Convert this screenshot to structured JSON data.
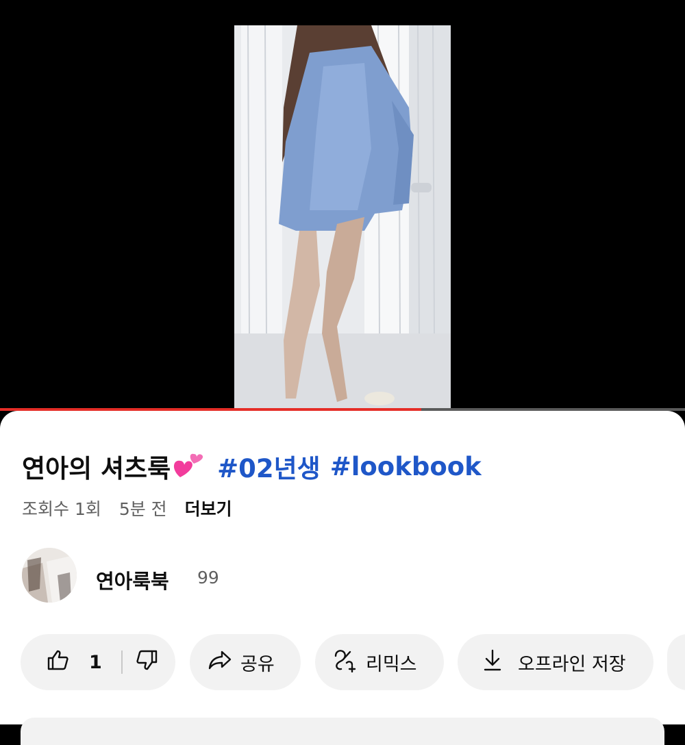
{
  "video": {
    "progress": 0.615,
    "title": "연아의 셔츠룩",
    "title_emoji": "two-hearts-emoji",
    "hashtags": [
      "#02년생",
      "#lookbook"
    ],
    "views": "조회수 1회",
    "uploaded": "5분 전",
    "more_label": "더보기"
  },
  "channel": {
    "name": "연아룩북",
    "subscribers": "99"
  },
  "actions": {
    "like_count": "1",
    "share_label": "공유",
    "remix_label": "리믹스",
    "download_label": "오프라인 저장"
  },
  "colors": {
    "progress": "#e52d27",
    "hashtag": "#1f57c8",
    "pill_bg": "#f2f2f2"
  },
  "icons": [
    "thumbs-up-icon",
    "thumbs-down-icon",
    "share-arrow-icon",
    "remix-icon",
    "download-icon"
  ]
}
